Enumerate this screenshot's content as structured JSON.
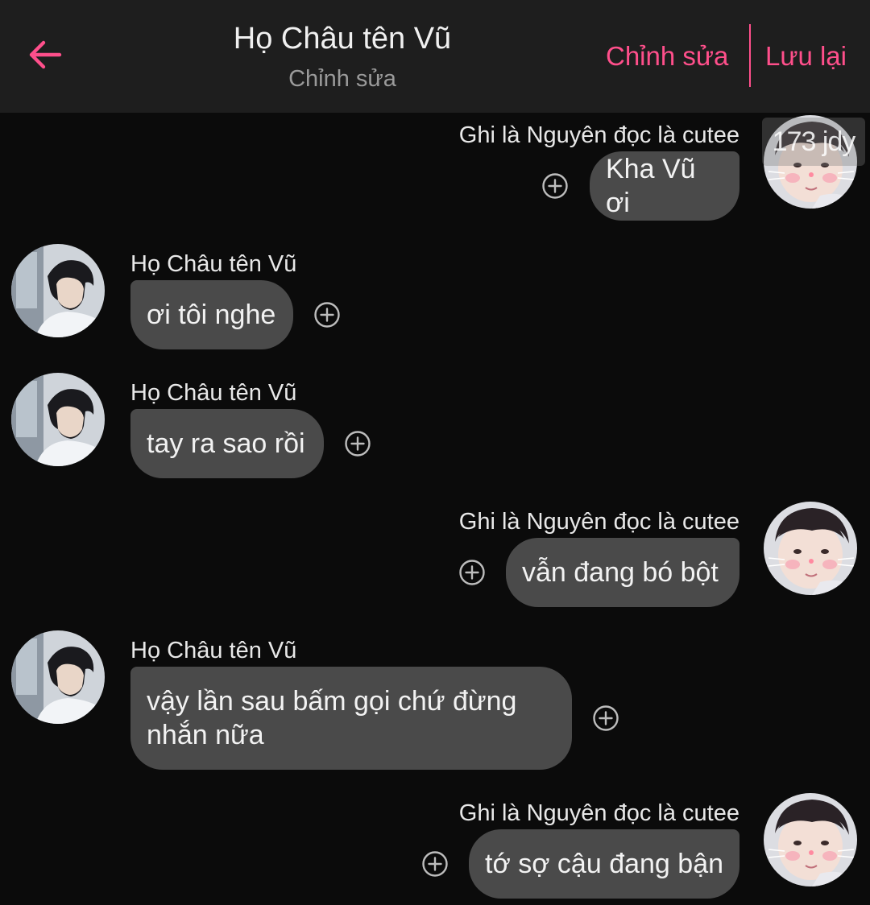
{
  "header": {
    "title": "Họ Châu tên Vũ",
    "subtitle": "Chỉnh sửa",
    "edit_label": "Chỉnh sửa",
    "save_label": "Lưu lại",
    "accent_color": "#ff4f8b",
    "back_icon": "arrow-left-icon"
  },
  "watermark": "173 jdy",
  "messages": [
    {
      "side": "right",
      "sender": "Ghi là Nguyên đọc là cutee",
      "text": "Kha Vũ ơi"
    },
    {
      "side": "left",
      "sender": "Họ Châu tên Vũ",
      "text": "ơi tôi nghe"
    },
    {
      "side": "left",
      "sender": "Họ Châu tên Vũ",
      "text": "tay ra sao rồi"
    },
    {
      "side": "right",
      "sender": "Ghi là Nguyên đọc là cutee",
      "text": "vẫn đang bó bột"
    },
    {
      "side": "left",
      "sender": "Họ Châu tên Vũ",
      "text": "vậy lần sau bấm gọi chứ đừng nhắn nữa"
    },
    {
      "side": "right",
      "sender": "Ghi là Nguyên đọc là cutee",
      "text": "tớ sợ cậu đang bận"
    }
  ]
}
